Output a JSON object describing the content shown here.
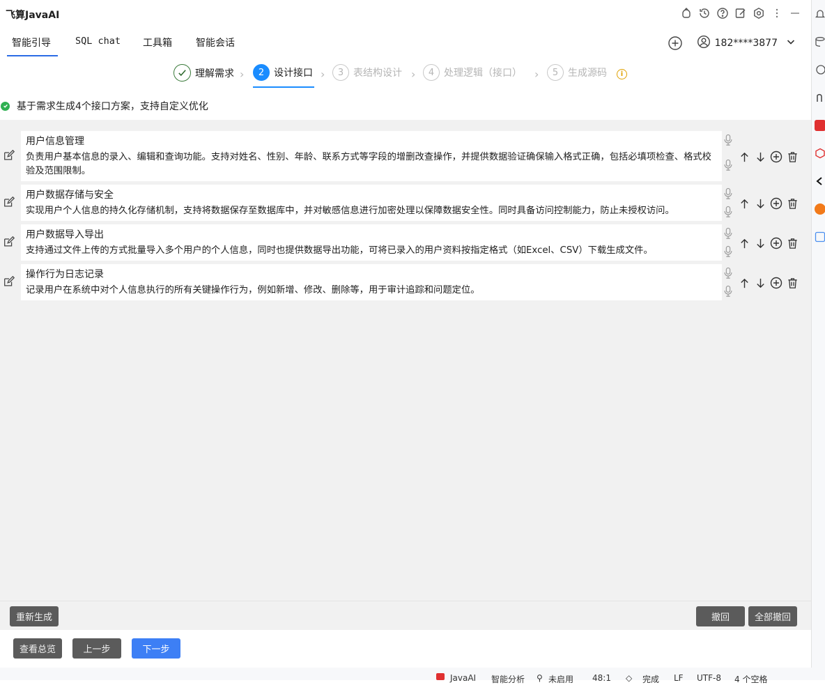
{
  "app": {
    "title": "飞算JavaAI"
  },
  "title_icons": [
    "plugin-icon",
    "history-icon",
    "help-icon",
    "edit-note-icon",
    "settings-icon",
    "more-vertical-icon",
    "minimize-icon"
  ],
  "nav": {
    "tabs": [
      {
        "label": "智能引导",
        "active": true
      },
      {
        "label": "SQL chat",
        "active": false
      },
      {
        "label": "工具箱",
        "active": false
      },
      {
        "label": "智能会话",
        "active": false
      }
    ],
    "user": "182****3877"
  },
  "steps": [
    {
      "num": "✓",
      "label": "理解需求",
      "state": "done"
    },
    {
      "num": "2",
      "label": "设计接口",
      "state": "current"
    },
    {
      "num": "3",
      "label": "表结构设计",
      "state": "pending"
    },
    {
      "num": "4",
      "label": "处理逻辑（接口）",
      "state": "pending"
    },
    {
      "num": "5",
      "label": "生成源码",
      "state": "pending"
    }
  ],
  "status_text": "基于需求生成4个接口方案，支持自定义优化",
  "items": [
    {
      "title": "用户信息管理",
      "desc": "负责用户基本信息的录入、编辑和查询功能。支持对姓名、性别、年龄、联系方式等字段的增删改查操作，并提供数据验证确保输入格式正确，包括必填项检查、格式校验及范围限制。"
    },
    {
      "title": "用户数据存储与安全",
      "desc": "实现用户个人信息的持久化存储机制，支持将数据保存至数据库中，并对敏感信息进行加密处理以保障数据安全性。同时具备访问控制能力，防止未授权访问。"
    },
    {
      "title": "用户数据导入导出",
      "desc": "支持通过文件上传的方式批量导入多个用户的个人信息，同时也提供数据导出功能，可将已录入的用户资料按指定格式（如Excel、CSV）下载生成文件。"
    },
    {
      "title": "操作行为日志记录",
      "desc": "记录用户在系统中对个人信息执行的所有关键操作行为，例如新增、修改、删除等，用于审计追踪和问题定位。"
    }
  ],
  "buttons": {
    "regenerate": "重新生成",
    "undo": "撤回",
    "undo_all": "全部撤回",
    "overview": "查看总览",
    "prev": "上一步",
    "next": "下一步"
  },
  "statusbar": {
    "plugin": "JavaAI",
    "analysis": "智能分析",
    "unused": "未启用",
    "position": "48:1",
    "done": "完成",
    "line_ending": "LF",
    "encoding": "UTF-8",
    "indent": "4 个空格"
  },
  "colors": {
    "accent": "#1a8cff",
    "primary_button": "#3d7ff5",
    "success": "#2fb052",
    "warning": "#e0a100"
  }
}
